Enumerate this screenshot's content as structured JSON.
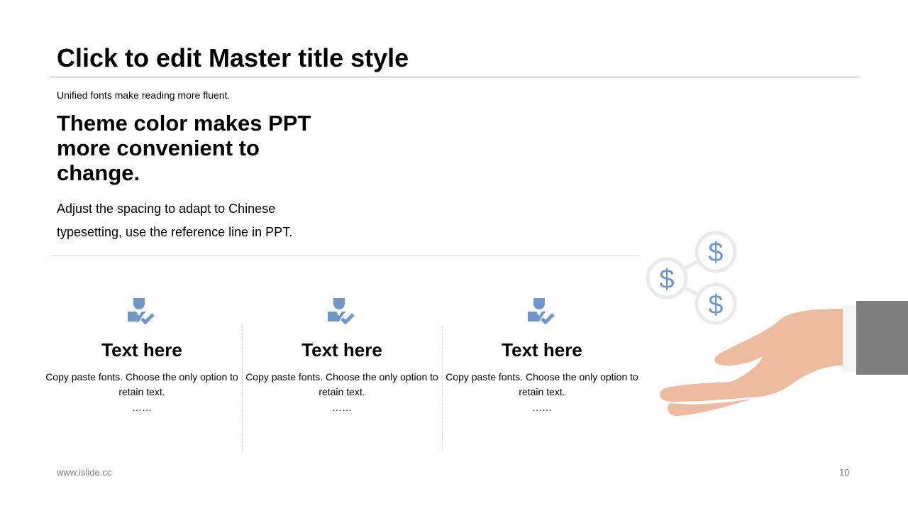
{
  "slide": {
    "title": "Click to edit Master title style",
    "subtitle": "Unified fonts make reading more fluent.",
    "headline": "Theme color makes PPT more convenient to change.",
    "body": "Adjust the spacing to adapt to Chinese typesetting, use the reference line in PPT."
  },
  "columns": [
    {
      "icon": "businessman-check-icon",
      "title": "Text here",
      "desc": "Copy paste fonts. Choose the only option to retain text.",
      "dots": "……"
    },
    {
      "icon": "businessman-check-icon",
      "title": "Text here",
      "desc": "Copy paste fonts. Choose the only option to retain text.",
      "dots": "……"
    },
    {
      "icon": "businessman-check-icon",
      "title": "Text here",
      "desc": "Copy paste fonts. Choose the only option to retain text.",
      "dots": "……"
    }
  ],
  "footer": {
    "url": "www.islide.cc",
    "page_number": "10"
  },
  "illustration": {
    "icons": [
      "dollar-icon",
      "dollar-icon",
      "dollar-icon",
      "hand-icon"
    ],
    "dollar_glyph": "$"
  },
  "colors": {
    "accent": "#7097c8",
    "skin": "#ecbba0",
    "sleeve": "#7f7f7f",
    "circle_ring": "#e8eaed"
  }
}
